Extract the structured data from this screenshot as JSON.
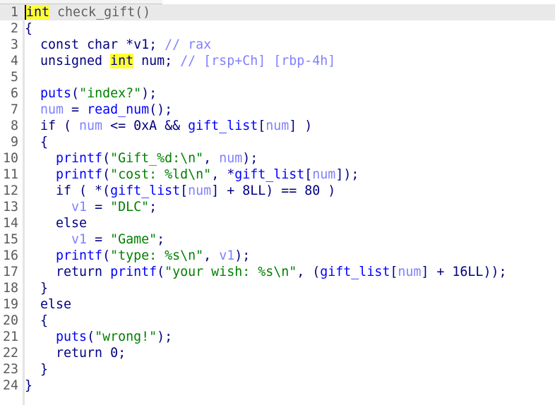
{
  "editor": {
    "current_line": 1,
    "lines": [
      [
        [
          "int",
          "h"
        ],
        [
          " check_gift()",
          "g"
        ]
      ],
      [
        [
          "{",
          "p"
        ]
      ],
      [
        [
          "  const char *v1; ",
          "p"
        ],
        [
          "// rax",
          "c"
        ]
      ],
      [
        [
          "  unsigned ",
          "p"
        ],
        [
          "int",
          "h"
        ],
        [
          " num; ",
          "p"
        ],
        [
          "// [rsp+Ch] [rbp-4h]",
          "c"
        ]
      ],
      [],
      [
        [
          "  ",
          "p"
        ],
        [
          "puts",
          "f"
        ],
        [
          "(",
          "p"
        ],
        [
          "\"index?\"",
          "s"
        ],
        [
          ");",
          "p"
        ]
      ],
      [
        [
          "  ",
          "p"
        ],
        [
          "num",
          "v"
        ],
        [
          " = ",
          "p"
        ],
        [
          "read_num",
          "f"
        ],
        [
          "();",
          "p"
        ]
      ],
      [
        [
          "  if ( ",
          "p"
        ],
        [
          "num",
          "v"
        ],
        [
          " <= 0xA && ",
          "p"
        ],
        [
          "gift_list",
          "f"
        ],
        [
          "[",
          "p"
        ],
        [
          "num",
          "v"
        ],
        [
          "] )",
          "p"
        ]
      ],
      [
        [
          "  {",
          "p"
        ]
      ],
      [
        [
          "    ",
          "p"
        ],
        [
          "printf",
          "f"
        ],
        [
          "(",
          "p"
        ],
        [
          "\"Gift_%d:\\n\"",
          "s"
        ],
        [
          ", ",
          "p"
        ],
        [
          "num",
          "v"
        ],
        [
          ");",
          "p"
        ]
      ],
      [
        [
          "    ",
          "p"
        ],
        [
          "printf",
          "f"
        ],
        [
          "(",
          "p"
        ],
        [
          "\"cost: %ld\\n\"",
          "s"
        ],
        [
          ", *",
          "p"
        ],
        [
          "gift_list",
          "f"
        ],
        [
          "[",
          "p"
        ],
        [
          "num",
          "v"
        ],
        [
          "]);",
          "p"
        ]
      ],
      [
        [
          "    if ( *(",
          "p"
        ],
        [
          "gift_list",
          "f"
        ],
        [
          "[",
          "p"
        ],
        [
          "num",
          "v"
        ],
        [
          "] + 8LL) == 80 )",
          "p"
        ]
      ],
      [
        [
          "      ",
          "p"
        ],
        [
          "v1",
          "v"
        ],
        [
          " = ",
          "p"
        ],
        [
          "\"DLC\"",
          "s"
        ],
        [
          ";",
          "p"
        ]
      ],
      [
        [
          "    else",
          "p"
        ]
      ],
      [
        [
          "      ",
          "p"
        ],
        [
          "v1",
          "v"
        ],
        [
          " = ",
          "p"
        ],
        [
          "\"Game\"",
          "s"
        ],
        [
          ";",
          "p"
        ]
      ],
      [
        [
          "    ",
          "p"
        ],
        [
          "printf",
          "f"
        ],
        [
          "(",
          "p"
        ],
        [
          "\"type: %s\\n\"",
          "s"
        ],
        [
          ", ",
          "p"
        ],
        [
          "v1",
          "v"
        ],
        [
          ");",
          "p"
        ]
      ],
      [
        [
          "    return ",
          "p"
        ],
        [
          "printf",
          "f"
        ],
        [
          "(",
          "p"
        ],
        [
          "\"your wish: %s\\n\"",
          "s"
        ],
        [
          ", (",
          "p"
        ],
        [
          "gift_list",
          "f"
        ],
        [
          "[",
          "p"
        ],
        [
          "num",
          "v"
        ],
        [
          "] + 16LL));",
          "p"
        ]
      ],
      [
        [
          "  }",
          "p"
        ]
      ],
      [
        [
          "  else",
          "p"
        ]
      ],
      [
        [
          "  {",
          "p"
        ]
      ],
      [
        [
          "    ",
          "p"
        ],
        [
          "puts",
          "f"
        ],
        [
          "(",
          "p"
        ],
        [
          "\"wrong!\"",
          "s"
        ],
        [
          ");",
          "p"
        ]
      ],
      [
        [
          "    return 0;",
          "p"
        ]
      ],
      [
        [
          "  }",
          "p"
        ]
      ],
      [
        [
          "}",
          "p"
        ]
      ]
    ]
  }
}
